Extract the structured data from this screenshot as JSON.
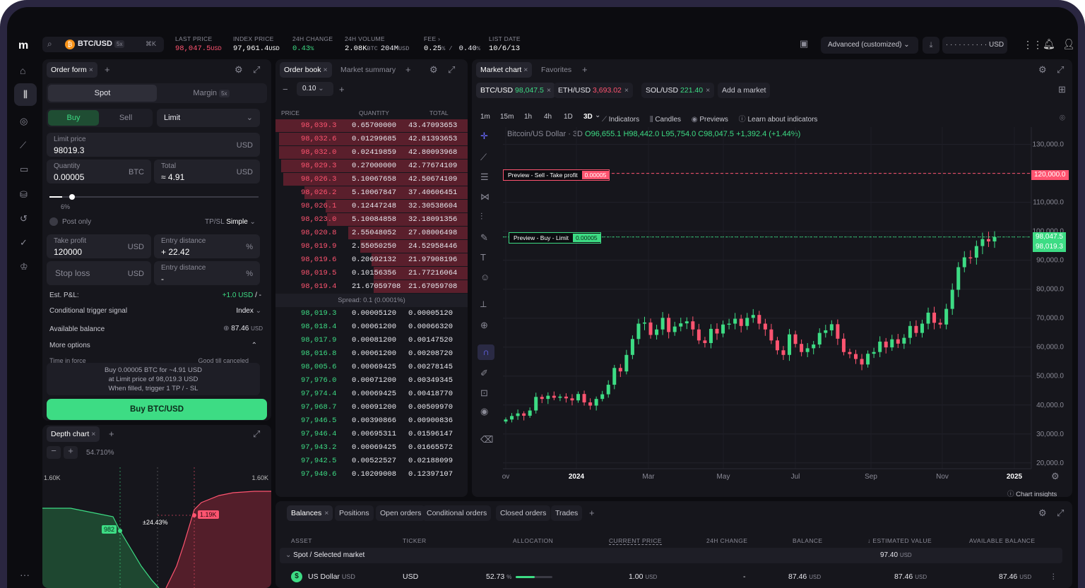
{
  "header": {
    "pair": "BTC/USD",
    "leverage": "5x",
    "shortcut": "⌘K",
    "stats": [
      {
        "label": "LAST PRICE",
        "value": "98,047.5",
        "unit": "USD",
        "color": "#ff5470"
      },
      {
        "label": "INDEX PRICE",
        "value": "97,961.4",
        "unit": "USD",
        "color": "#ffffff"
      },
      {
        "label": "24H CHANGE",
        "value": "0.43",
        "unit": "%",
        "color": "#3ddc84"
      },
      {
        "label": "24H VOLUME",
        "value": "2.08K",
        "unit": "BTC",
        "value2": "204M",
        "unit2": "USD",
        "color": "#ffffff"
      },
      {
        "label": "FEE ›",
        "value": "0.25",
        "unit": "% / ",
        "value2": "0.40",
        "unit2": "%",
        "color": "#ffffff"
      },
      {
        "label": "LIST DATE",
        "value": "10/6/13",
        "unit": "",
        "color": "#ffffff"
      }
    ],
    "layout": "Advanced (customized)",
    "balance": "· · · · · · · · · · USD"
  },
  "orderform": {
    "tab": "Order form",
    "spot": "Spot",
    "margin": "Margin",
    "margin_badge": "5x",
    "buy": "Buy",
    "sell": "Sell",
    "type": "Limit",
    "limit_label": "Limit price",
    "limit_value": "98019.3",
    "limit_unit": "USD",
    "qty_label": "Quantity",
    "qty_value": "0.00005",
    "qty_unit": "BTC",
    "total_label": "Total",
    "total_value": "≈ 4.91",
    "total_unit": "USD",
    "slider_pct": "6%",
    "slider_value": 0.06,
    "postonly": "Post only",
    "tpsl": "TP/SL",
    "tpsl_mode": "Simple",
    "tp_label": "Take profit",
    "tp_value": "120000",
    "tp_unit": "USD",
    "entry_label": "Entry distance",
    "entry_value": "+ 22.42",
    "entry_unit": "%",
    "sl_label": "Stop loss",
    "sl_unit": "USD",
    "entry2_label": "Entry distance",
    "entry2_value": "-",
    "entry2_unit": "%",
    "pnl_label": "Est. P&L:",
    "pnl_value": "+1.0 USD",
    "pnl_sep": "/ -",
    "trigger_label": "Conditional trigger signal",
    "trigger_value": "Index",
    "avail_label": "Available balance",
    "avail_value": "87.46",
    "avail_unit": "USD",
    "more": "More options",
    "tif_label": "Time in force",
    "tif_value": "Good till canceled",
    "summary1": "Buy 0.00005 BTC for ~4.91 USD",
    "summary2": "at Limit price of 98,019.3 USD",
    "summary3": "When filled, trigger 1 TP / - SL",
    "submit": "Buy BTC/USD"
  },
  "depth": {
    "tab": "Depth chart",
    "pct": "54.710%",
    "left_top": "1.60K",
    "right_top": "1.60K",
    "bid_tag": "982",
    "spread_tag": "±24.43%",
    "ask_tag": "1.19K"
  },
  "orderbook": {
    "tab": "Order book",
    "tab2": "Market summary",
    "tick": "0.10",
    "cols": [
      "PRICE",
      "QUANTITY",
      "TOTAL"
    ],
    "asks": [
      [
        "98,039.3",
        "0.65700000",
        "43.47093653",
        1.0
      ],
      [
        "98,032.6",
        "0.01299685",
        "42.81393653",
        0.98
      ],
      [
        "98,032.0",
        "0.02419859",
        "42.80093968",
        0.98
      ],
      [
        "98,029.3",
        "0.27000000",
        "42.77674109",
        0.97
      ],
      [
        "98,026.3",
        "5.10067658",
        "42.50674109",
        0.96
      ],
      [
        "98,026.2",
        "5.10067847",
        "37.40606451",
        0.85
      ],
      [
        "98,026.1",
        "0.12447248",
        "32.30538604",
        0.74
      ],
      [
        "98,023.0",
        "5.10084858",
        "32.18091356",
        0.73
      ],
      [
        "98,020.8",
        "2.55048052",
        "27.08006498",
        0.62
      ],
      [
        "98,019.9",
        "2.55050250",
        "24.52958446",
        0.56
      ],
      [
        "98,019.6",
        "0.20692132",
        "21.97908196",
        0.5
      ],
      [
        "98,019.5",
        "0.10156356",
        "21.77216064",
        0.49
      ],
      [
        "98,019.4",
        "21.67059708",
        "21.67059708",
        0.49
      ]
    ],
    "spread": "Spread: 0.1 (0.0001%)",
    "bids": [
      [
        "98,019.3",
        "0.00005120",
        "0.00005120"
      ],
      [
        "98,018.4",
        "0.00061200",
        "0.00066320"
      ],
      [
        "98,017.9",
        "0.00081200",
        "0.00147520"
      ],
      [
        "98,016.8",
        "0.00061200",
        "0.00208720"
      ],
      [
        "98,005.6",
        "0.00069425",
        "0.00278145"
      ],
      [
        "97,976.0",
        "0.00071200",
        "0.00349345"
      ],
      [
        "97,974.4",
        "0.00069425",
        "0.00418770"
      ],
      [
        "97,968.7",
        "0.00091200",
        "0.00509970"
      ],
      [
        "97,946.5",
        "0.00390866",
        "0.00900836"
      ],
      [
        "97,946.4",
        "0.00695311",
        "0.01596147"
      ],
      [
        "97,943.2",
        "0.00069425",
        "0.01665572"
      ],
      [
        "97,942.5",
        "0.00522527",
        "0.02188099"
      ],
      [
        "97,940.6",
        "0.10209008",
        "0.12397107"
      ]
    ]
  },
  "chart": {
    "tab": "Market chart",
    "tab2": "Favorites",
    "markets": [
      {
        "name": "BTC/USD",
        "price": "98,047.5",
        "color": "#3ddc84"
      },
      {
        "name": "ETH/USD",
        "price": "3,693.02",
        "color": "#ff5470"
      },
      {
        "name": "SOL/USD",
        "price": "221.40",
        "color": "#3ddc84"
      }
    ],
    "add_market": "Add a market",
    "intervals": [
      "1m",
      "15m",
      "1h",
      "4h",
      "1D",
      "3D"
    ],
    "active_interval": "3D",
    "tools": [
      "Indicators",
      "Candles",
      "Previews",
      "Learn about indicators"
    ],
    "legend_title": "Bitcoin/US Dollar · 3D",
    "ohlc": "O96,655.1 H98,442.0 L95,754.0 C98,047.5 +1,392.4 (+1.44%)",
    "sell_preview": "Preview - Sell - Take profit",
    "sell_qty": "0.00005",
    "sell_price": "120,000.0",
    "buy_preview": "Preview - Buy - Limit",
    "buy_qty": "0.00005",
    "last_tag": "98,047.5",
    "buy_tag": "98,019.3",
    "insights": "Chart insights",
    "y_ticks": [
      "130,000.0",
      "120,000.0",
      "110,000.0",
      "100,000.0",
      "90,000.0",
      "80,000.0",
      "70,000.0",
      "60,000.0",
      "50,000.0",
      "40,000.0",
      "30,000.0",
      "20,000.0"
    ],
    "x_ticks": [
      "ov",
      "2024",
      "Mar",
      "May",
      "Jul",
      "Sep",
      "Nov",
      "2025"
    ]
  },
  "chart_data": {
    "type": "candlestick",
    "title": "Bitcoin/US Dollar · 3D",
    "ylim": [
      18000,
      136000
    ],
    "close": [
      35000,
      36200,
      37100,
      36300,
      38100,
      42800,
      42100,
      43200,
      42500,
      42900,
      42300,
      41600,
      43800,
      40900,
      39800,
      42100,
      43700,
      47000,
      52800,
      51600,
      57300,
      62800,
      68100,
      68500,
      64200,
      66100,
      70100,
      65200,
      67100,
      68200,
      68900,
      66100,
      62300,
      61400,
      66300,
      64700,
      67800,
      68100,
      69800,
      67300,
      70100,
      71100,
      68100,
      66100,
      62300,
      58900,
      57300,
      64400,
      61100,
      58300,
      59600,
      60900,
      64900,
      65800,
      67900,
      62900,
      58300,
      57600,
      55900,
      54000,
      57700,
      58300,
      61900,
      59900,
      62700,
      61200,
      63200,
      67300,
      64900,
      68100,
      71900,
      68400,
      67800,
      73200,
      79800,
      87600,
      91000,
      90900,
      94900,
      97300,
      96500,
      98050
    ]
  },
  "balances": {
    "tabs": [
      "Balances",
      "Positions",
      "Open orders",
      "Conditional orders",
      "Closed orders",
      "Trades"
    ],
    "cols": [
      "ASSET",
      "TICKER",
      "ALLOCATION",
      "CURRENT PRICE",
      "24H CHANGE",
      "BALANCE",
      "↓ ESTIMATED VALUE",
      "AVAILABLE BALANCE"
    ],
    "group": "Spot / Selected market",
    "group_total": "97.40",
    "row": {
      "asset": "US Dollar",
      "asset_unit": "USD",
      "ticker": "USD",
      "alloc": "52.73",
      "alloc_value": 0.5273,
      "price": "1.00",
      "change": "-",
      "balance": "87.46",
      "est": "87.46",
      "avail": "87.46"
    }
  },
  "colors": {
    "green": "#3ddc84",
    "red": "#ff5470",
    "bg": "#16161c"
  }
}
